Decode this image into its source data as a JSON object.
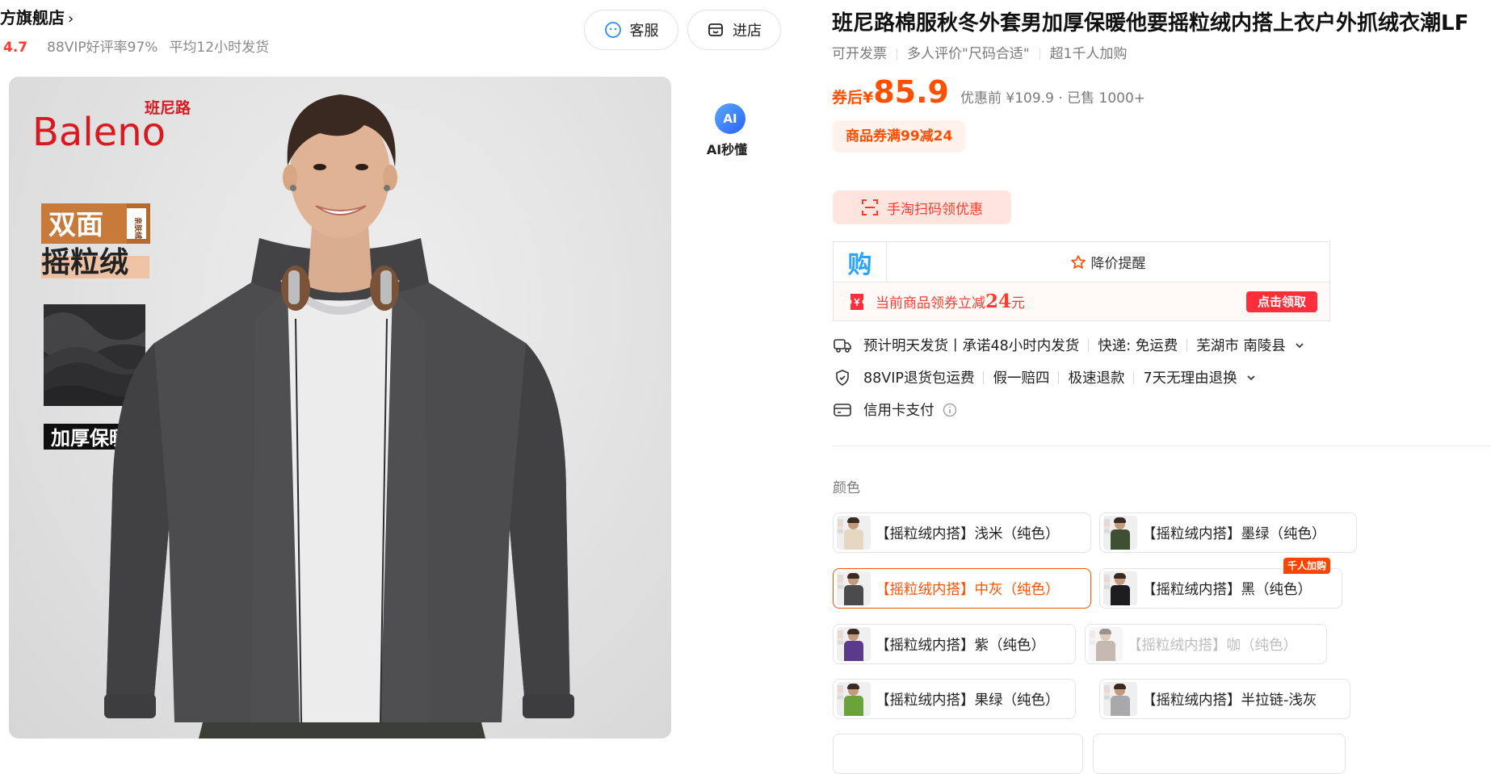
{
  "store": {
    "name": "方旗舰店",
    "rating": "4.7",
    "vip_rate": "88VIP好评率97%",
    "ship_time": "平均12小时发货",
    "service_label": "客服",
    "enter_label": "进店"
  },
  "hero_image": {
    "brand_cn": "班尼路",
    "brand_en": "Baleno",
    "badge_1": "双面",
    "badge_1_side": "亲肤绒",
    "badge_2": "摇粒绒",
    "badge_3": "加厚保暖",
    "jacket_color": "#4c4c4e"
  },
  "ai": {
    "icon_text": "AI",
    "label": "AI秒懂"
  },
  "product": {
    "title": "班尼路棉服秋冬外套男加厚保暖他要摇粒绒内搭上衣户外抓绒衣潮LF",
    "tags": [
      "可开发票",
      "多人评价\"尺码合适\"",
      "超1千人加购"
    ],
    "price_prefix": "券后¥",
    "price": "85.9",
    "original": "优惠前 ¥109.9 · 已售 1000+",
    "coupon_tag": "商品券满99减24",
    "scan_label": "手淘扫码领优惠"
  },
  "deal_box": {
    "logo": "购",
    "watch_label": "降价提醒",
    "coupon_text": "当前商品领券立减",
    "coupon_amount": "24",
    "coupon_unit": "元",
    "claim_label": "点击领取"
  },
  "services": {
    "ship": [
      "预计明天发货",
      "承诺48小时内发货",
      "快递: 免运费",
      "芜湖市 南陵县"
    ],
    "ship_sep": "丨",
    "returns": [
      "88VIP退货包运费",
      "假一赔四",
      "极速退款",
      "7天无理由退换"
    ],
    "payment": "信用卡支付"
  },
  "colors": {
    "label": "颜色",
    "options": [
      {
        "label": "【摇粒绒内搭】浅米（纯色）",
        "swatch": "#e6d7c0"
      },
      {
        "label": "【摇粒绒内搭】墨绿（纯色）",
        "swatch": "#3f4f34"
      },
      {
        "label": "【摇粒绒内搭】中灰（纯色）",
        "swatch": "#4b4b4d",
        "selected": true
      },
      {
        "label": "【摇粒绒内搭】黑（纯色）",
        "swatch": "#1d1d20",
        "badge": "千人加购"
      },
      {
        "label": "【摇粒绒内搭】紫（纯色）",
        "swatch": "#5b3a8c"
      },
      {
        "label": "【摇粒绒内搭】咖（纯色）",
        "swatch": "#8d7566",
        "disabled": true
      },
      {
        "label": "【摇粒绒内搭】果绿（纯色）",
        "swatch": "#6aa33a"
      },
      {
        "label": "【摇粒绒内搭】半拉链-浅灰",
        "swatch": "#a9a9ab"
      }
    ]
  }
}
